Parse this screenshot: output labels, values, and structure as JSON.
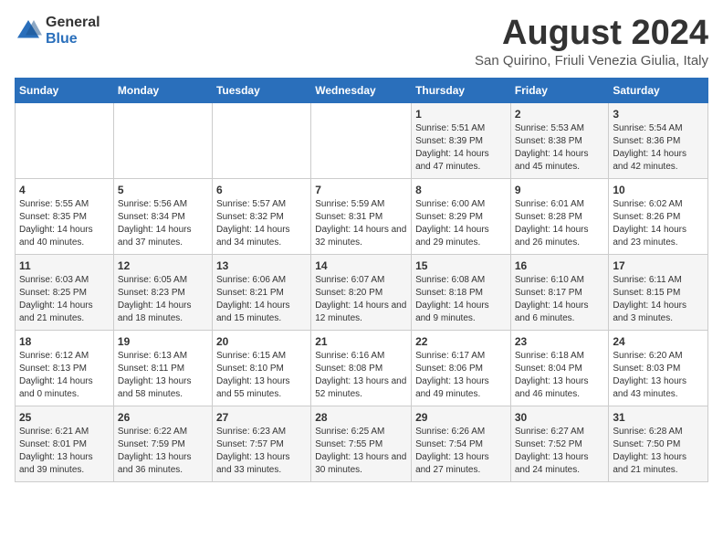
{
  "logo": {
    "general": "General",
    "blue": "Blue"
  },
  "title": {
    "month_year": "August 2024",
    "location": "San Quirino, Friuli Venezia Giulia, Italy"
  },
  "headers": [
    "Sunday",
    "Monday",
    "Tuesday",
    "Wednesday",
    "Thursday",
    "Friday",
    "Saturday"
  ],
  "weeks": [
    [
      {
        "day": "",
        "info": ""
      },
      {
        "day": "",
        "info": ""
      },
      {
        "day": "",
        "info": ""
      },
      {
        "day": "",
        "info": ""
      },
      {
        "day": "1",
        "info": "Sunrise: 5:51 AM\nSunset: 8:39 PM\nDaylight: 14 hours and 47 minutes."
      },
      {
        "day": "2",
        "info": "Sunrise: 5:53 AM\nSunset: 8:38 PM\nDaylight: 14 hours and 45 minutes."
      },
      {
        "day": "3",
        "info": "Sunrise: 5:54 AM\nSunset: 8:36 PM\nDaylight: 14 hours and 42 minutes."
      }
    ],
    [
      {
        "day": "4",
        "info": "Sunrise: 5:55 AM\nSunset: 8:35 PM\nDaylight: 14 hours and 40 minutes."
      },
      {
        "day": "5",
        "info": "Sunrise: 5:56 AM\nSunset: 8:34 PM\nDaylight: 14 hours and 37 minutes."
      },
      {
        "day": "6",
        "info": "Sunrise: 5:57 AM\nSunset: 8:32 PM\nDaylight: 14 hours and 34 minutes."
      },
      {
        "day": "7",
        "info": "Sunrise: 5:59 AM\nSunset: 8:31 PM\nDaylight: 14 hours and 32 minutes."
      },
      {
        "day": "8",
        "info": "Sunrise: 6:00 AM\nSunset: 8:29 PM\nDaylight: 14 hours and 29 minutes."
      },
      {
        "day": "9",
        "info": "Sunrise: 6:01 AM\nSunset: 8:28 PM\nDaylight: 14 hours and 26 minutes."
      },
      {
        "day": "10",
        "info": "Sunrise: 6:02 AM\nSunset: 8:26 PM\nDaylight: 14 hours and 23 minutes."
      }
    ],
    [
      {
        "day": "11",
        "info": "Sunrise: 6:03 AM\nSunset: 8:25 PM\nDaylight: 14 hours and 21 minutes."
      },
      {
        "day": "12",
        "info": "Sunrise: 6:05 AM\nSunset: 8:23 PM\nDaylight: 14 hours and 18 minutes."
      },
      {
        "day": "13",
        "info": "Sunrise: 6:06 AM\nSunset: 8:21 PM\nDaylight: 14 hours and 15 minutes."
      },
      {
        "day": "14",
        "info": "Sunrise: 6:07 AM\nSunset: 8:20 PM\nDaylight: 14 hours and 12 minutes."
      },
      {
        "day": "15",
        "info": "Sunrise: 6:08 AM\nSunset: 8:18 PM\nDaylight: 14 hours and 9 minutes."
      },
      {
        "day": "16",
        "info": "Sunrise: 6:10 AM\nSunset: 8:17 PM\nDaylight: 14 hours and 6 minutes."
      },
      {
        "day": "17",
        "info": "Sunrise: 6:11 AM\nSunset: 8:15 PM\nDaylight: 14 hours and 3 minutes."
      }
    ],
    [
      {
        "day": "18",
        "info": "Sunrise: 6:12 AM\nSunset: 8:13 PM\nDaylight: 14 hours and 0 minutes."
      },
      {
        "day": "19",
        "info": "Sunrise: 6:13 AM\nSunset: 8:11 PM\nDaylight: 13 hours and 58 minutes."
      },
      {
        "day": "20",
        "info": "Sunrise: 6:15 AM\nSunset: 8:10 PM\nDaylight: 13 hours and 55 minutes."
      },
      {
        "day": "21",
        "info": "Sunrise: 6:16 AM\nSunset: 8:08 PM\nDaylight: 13 hours and 52 minutes."
      },
      {
        "day": "22",
        "info": "Sunrise: 6:17 AM\nSunset: 8:06 PM\nDaylight: 13 hours and 49 minutes."
      },
      {
        "day": "23",
        "info": "Sunrise: 6:18 AM\nSunset: 8:04 PM\nDaylight: 13 hours and 46 minutes."
      },
      {
        "day": "24",
        "info": "Sunrise: 6:20 AM\nSunset: 8:03 PM\nDaylight: 13 hours and 43 minutes."
      }
    ],
    [
      {
        "day": "25",
        "info": "Sunrise: 6:21 AM\nSunset: 8:01 PM\nDaylight: 13 hours and 39 minutes."
      },
      {
        "day": "26",
        "info": "Sunrise: 6:22 AM\nSunset: 7:59 PM\nDaylight: 13 hours and 36 minutes."
      },
      {
        "day": "27",
        "info": "Sunrise: 6:23 AM\nSunset: 7:57 PM\nDaylight: 13 hours and 33 minutes."
      },
      {
        "day": "28",
        "info": "Sunrise: 6:25 AM\nSunset: 7:55 PM\nDaylight: 13 hours and 30 minutes."
      },
      {
        "day": "29",
        "info": "Sunrise: 6:26 AM\nSunset: 7:54 PM\nDaylight: 13 hours and 27 minutes."
      },
      {
        "day": "30",
        "info": "Sunrise: 6:27 AM\nSunset: 7:52 PM\nDaylight: 13 hours and 24 minutes."
      },
      {
        "day": "31",
        "info": "Sunrise: 6:28 AM\nSunset: 7:50 PM\nDaylight: 13 hours and 21 minutes."
      }
    ]
  ]
}
